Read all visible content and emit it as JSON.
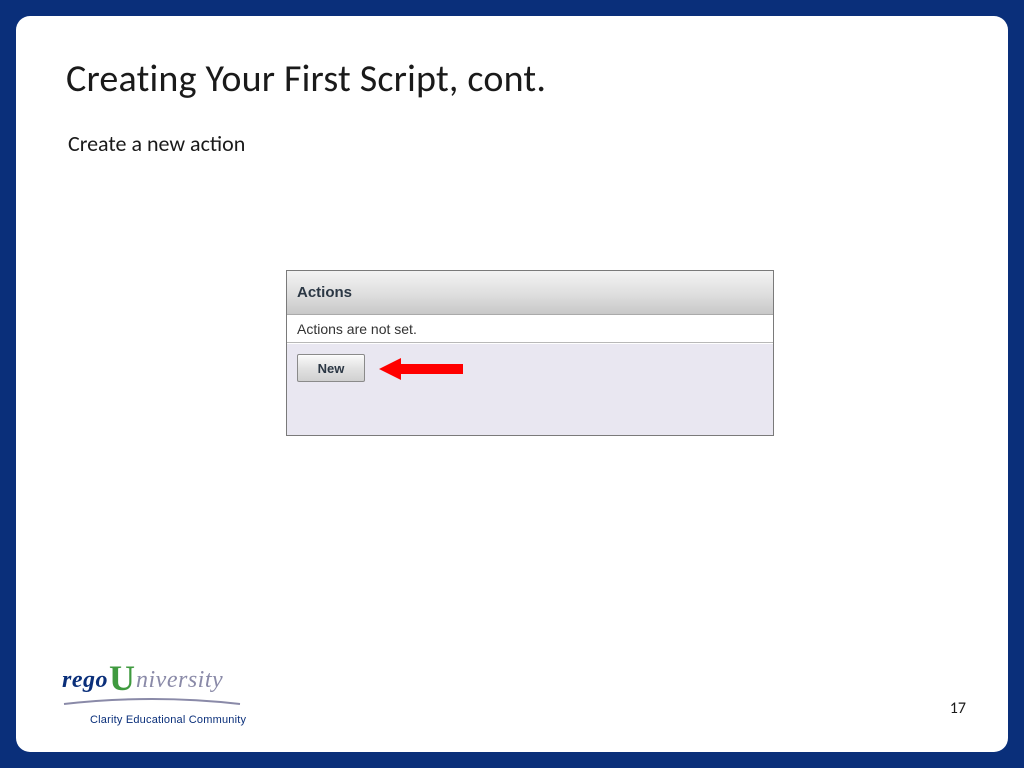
{
  "slide": {
    "title": "Creating Your First Script, cont.",
    "subtitle": "Create a new action"
  },
  "actions_panel": {
    "header": "Actions",
    "empty_message": "Actions are not set.",
    "new_button_label": "New"
  },
  "footer": {
    "logo_part1": "rego",
    "logo_part2": "U",
    "logo_part3": "niversity",
    "tagline": "Clarity Educational Community",
    "page_number": "17"
  },
  "colors": {
    "frame": "#0a2f7a",
    "arrow": "#ff0000",
    "logo_blue": "#0a2f7a",
    "logo_green": "#3f9a3f",
    "logo_grey": "#8a8aa8"
  }
}
